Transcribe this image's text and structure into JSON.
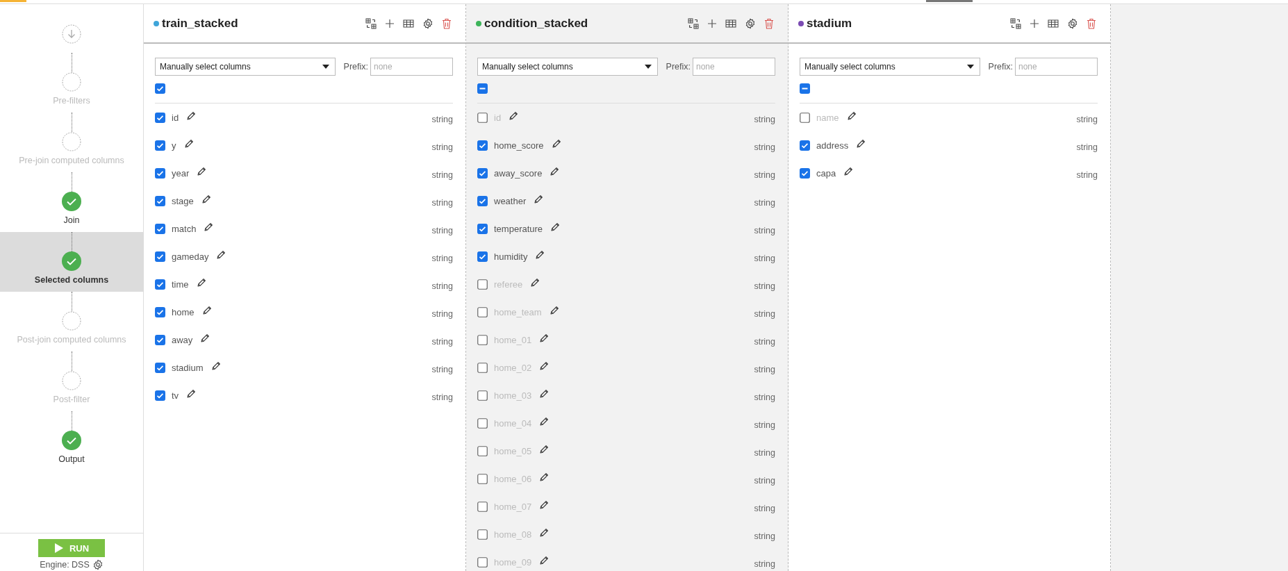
{
  "steps": [
    {
      "kind": "start",
      "selected": false
    },
    {
      "kind": "step",
      "label": "Pre-filters",
      "done": false,
      "selected": false
    },
    {
      "kind": "step",
      "label": "Pre-join computed columns",
      "done": false,
      "selected": false
    },
    {
      "kind": "step",
      "label": "Join",
      "done": true,
      "selected": false
    },
    {
      "kind": "step",
      "label": "Selected columns",
      "done": true,
      "selected": true
    },
    {
      "kind": "step",
      "label": "Post-join computed columns",
      "done": false,
      "selected": false
    },
    {
      "kind": "step",
      "label": "Post-filter",
      "done": false,
      "selected": false
    },
    {
      "kind": "step",
      "label": "Output",
      "done": true,
      "selected": false
    }
  ],
  "run_button": {
    "label": "RUN"
  },
  "engine": "Engine: DSS",
  "datasets": [
    {
      "name": "train_stacked",
      "color": "#3fa5d9",
      "highlighted": false,
      "mode": "Manually select columns",
      "prefix_label": "Prefix:",
      "prefix": {
        "placeholder": "none"
      },
      "select_all": {
        "checked": true
      },
      "columns": [
        {
          "name": "id",
          "type": "string",
          "checked": true
        },
        {
          "name": "y",
          "type": "string",
          "checked": true
        },
        {
          "name": "year",
          "type": "string",
          "checked": true
        },
        {
          "name": "stage",
          "type": "string",
          "checked": true
        },
        {
          "name": "match",
          "type": "string",
          "checked": true
        },
        {
          "name": "gameday",
          "type": "string",
          "checked": true
        },
        {
          "name": "time",
          "type": "string",
          "checked": true
        },
        {
          "name": "home",
          "type": "string",
          "checked": true
        },
        {
          "name": "away",
          "type": "string",
          "checked": true
        },
        {
          "name": "stadium",
          "type": "string",
          "checked": true
        },
        {
          "name": "tv",
          "type": "string",
          "checked": true
        }
      ]
    },
    {
      "name": "condition_stacked",
      "color": "#3db45a",
      "highlighted": true,
      "mode": "Manually select columns",
      "prefix_label": "Prefix:",
      "prefix": {
        "placeholder": "none"
      },
      "select_all": {
        "partial": true
      },
      "columns": [
        {
          "name": "id",
          "type": "string",
          "checked": false
        },
        {
          "name": "home_score",
          "type": "string",
          "checked": true
        },
        {
          "name": "away_score",
          "type": "string",
          "checked": true
        },
        {
          "name": "weather",
          "type": "string",
          "checked": true
        },
        {
          "name": "temperature",
          "type": "string",
          "checked": true
        },
        {
          "name": "humidity",
          "type": "string",
          "checked": true
        },
        {
          "name": "referee",
          "type": "string",
          "checked": false
        },
        {
          "name": "home_team",
          "type": "string",
          "checked": false
        },
        {
          "name": "home_01",
          "type": "string",
          "checked": false
        },
        {
          "name": "home_02",
          "type": "string",
          "checked": false
        },
        {
          "name": "home_03",
          "type": "string",
          "checked": false
        },
        {
          "name": "home_04",
          "type": "string",
          "checked": false
        },
        {
          "name": "home_05",
          "type": "string",
          "checked": false
        },
        {
          "name": "home_06",
          "type": "string",
          "checked": false
        },
        {
          "name": "home_07",
          "type": "string",
          "checked": false
        },
        {
          "name": "home_08",
          "type": "string",
          "checked": false
        },
        {
          "name": "home_09",
          "type": "string",
          "checked": false
        }
      ]
    },
    {
      "name": "stadium",
      "color": "#7b4bb3",
      "highlighted": false,
      "mode": "Manually select columns",
      "prefix_label": "Prefix:",
      "prefix": {
        "placeholder": "none"
      },
      "select_all": {
        "partial": true
      },
      "columns": [
        {
          "name": "name",
          "type": "string",
          "checked": false
        },
        {
          "name": "address",
          "type": "string",
          "checked": true
        },
        {
          "name": "capa",
          "type": "string",
          "checked": true
        }
      ]
    }
  ]
}
